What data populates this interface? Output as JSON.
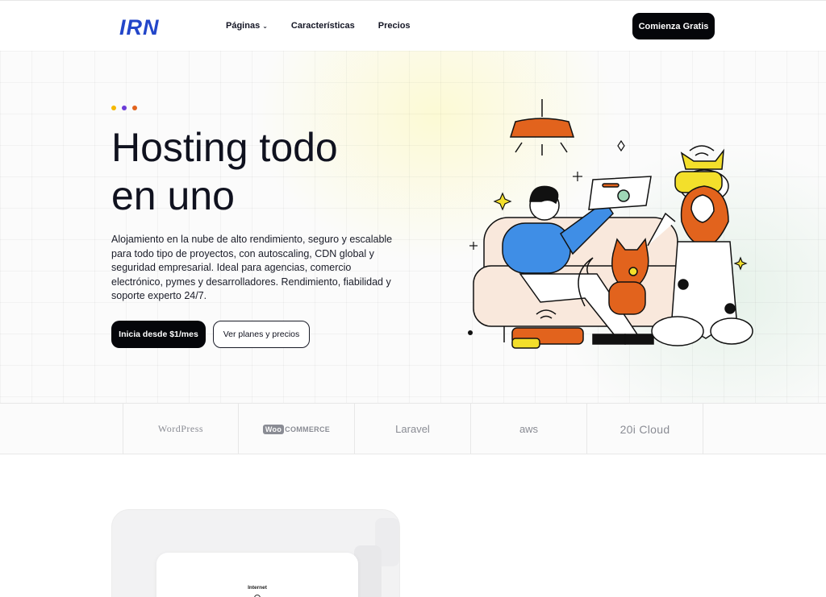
{
  "header": {
    "logo": "IRN",
    "nav": [
      {
        "label": "Páginas",
        "has_dropdown": true
      },
      {
        "label": "Características",
        "has_dropdown": false
      },
      {
        "label": "Precios",
        "has_dropdown": false
      }
    ],
    "cta": "Comienza Gratis"
  },
  "hero": {
    "dot_colors": [
      "#f5b800",
      "#6b3bd8",
      "#e2631d"
    ],
    "title_line1": "Hosting todo",
    "title_line2": "en uno",
    "description": "Alojamiento en la nube de alto rendimiento, seguro y escalable para todo tipo de proyectos, con autoscaling, CDN global y seguridad empresarial. Ideal para agencias, comercio electrónico, pymes y desarrolladores. Rendimiento, fiabilidad y soporte experto 24/7.",
    "primary_button": "Inicia desde $1/mes",
    "secondary_button": "Ver planes y precios"
  },
  "partners": {
    "wordpress": "WordPress",
    "woo_badge": "Woo",
    "woo_text": "COMMERCE",
    "laravel": "Laravel",
    "aws": "aws",
    "cloud": "20i Cloud"
  },
  "lower": {
    "inner_label": "Internet"
  },
  "colors": {
    "brand": "#2346c9",
    "accent_orange": "#e2631d",
    "accent_yellow": "#f3df2b",
    "accent_blue": "#3f8ee6"
  }
}
